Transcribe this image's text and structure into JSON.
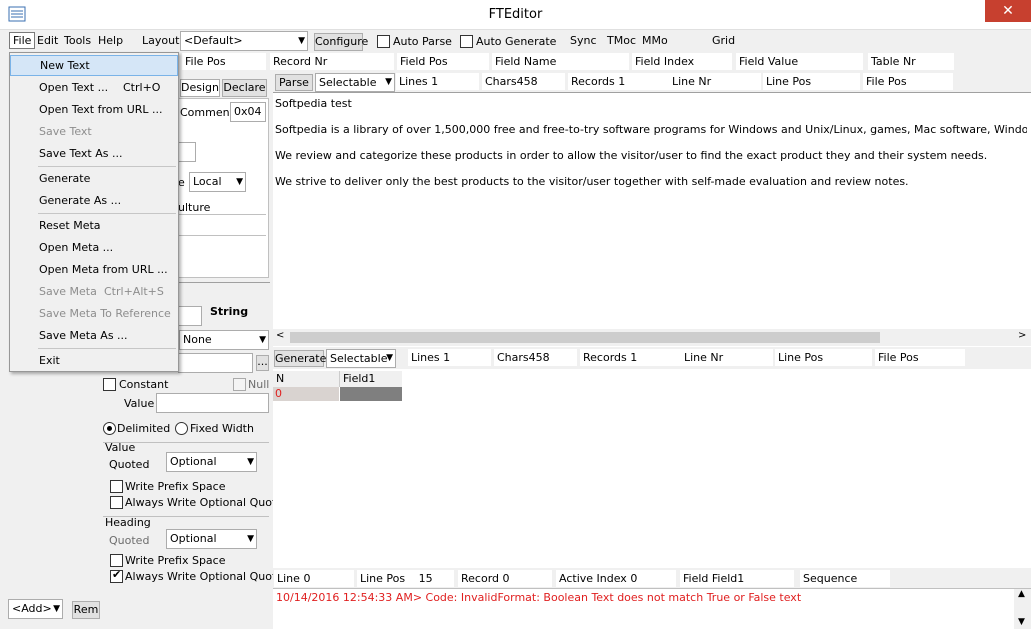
{
  "window": {
    "title": "FTEditor",
    "close": "✕"
  },
  "menubar": {
    "file": "File",
    "edit": "Edit",
    "tools": "Tools",
    "help": "Help",
    "layout": "Layout"
  },
  "toolbar": {
    "layout_value": "<Default>",
    "configure": "Configure",
    "auto_parse": "Auto Parse",
    "auto_generate": "Auto Generate",
    "sync": "Sync",
    "tmoc": "TMoc",
    "mmo": "MMo",
    "grid": "Grid"
  },
  "field_header": [
    "File Pos",
    "Record Nr",
    "Field Pos",
    "Field Name",
    "Field Index",
    "Field Value",
    "Table Nr"
  ],
  "file_menu": {
    "items": [
      {
        "label": "New Text",
        "shortcut": "",
        "disabled": false
      },
      {
        "label": "Open Text ...",
        "shortcut": "Ctrl+O",
        "disabled": false
      },
      {
        "label": "Open Text from URL ...",
        "shortcut": "",
        "disabled": false
      },
      {
        "label": "Save Text",
        "shortcut": "",
        "disabled": true
      },
      {
        "label": "Save Text As ...",
        "shortcut": "",
        "disabled": false
      },
      {
        "label": "Generate",
        "shortcut": "",
        "disabled": false
      },
      {
        "label": "Generate As ...",
        "shortcut": "",
        "disabled": false
      },
      {
        "label": "Reset Meta",
        "shortcut": "",
        "disabled": false
      },
      {
        "label": "Open Meta ...",
        "shortcut": "",
        "disabled": false
      },
      {
        "label": "Open Meta from URL ...",
        "shortcut": "",
        "disabled": false
      },
      {
        "label": "Save Meta",
        "shortcut": "Ctrl+Alt+S",
        "disabled": true
      },
      {
        "label": "Save Meta To Reference",
        "shortcut": "",
        "disabled": true
      },
      {
        "label": "Save Meta As ...",
        "shortcut": "",
        "disabled": false
      },
      {
        "label": "Exit",
        "shortcut": "",
        "disabled": false
      }
    ]
  },
  "left": {
    "tab_design": "Design",
    "tab_declare": "Declare",
    "comment_label": "Comment",
    "comment_value": "0x04",
    "local_value": "Local",
    "culture_label": "ulture",
    "string_label": "String",
    "none_value": "None",
    "constant": "Constant",
    "null_label": "Null",
    "value_label": "Value",
    "delimited": "Delimited",
    "fixed_width": "Fixed Width",
    "value_section": "Value",
    "quoted_label": "Quoted",
    "quoted_value": "Optional",
    "write_prefix_space": "Write Prefix Space",
    "always_write_optional_quote": "Always Write Optional Quote",
    "heading_section": "Heading",
    "heading_quoted_label": "Quoted",
    "heading_quoted_value": "Optional",
    "heading_write_prefix_space": "Write Prefix Space",
    "heading_always_write_optional_quote": "Always Write Optional Quote",
    "add_button": "<Add>",
    "rem_button": "Rem",
    "ellipsis": "..."
  },
  "parse_bar": {
    "parse": "Parse",
    "selectable": "Selectable",
    "lines": "Lines",
    "lines_value": "1",
    "chars": "Chars",
    "chars_value": "458",
    "records": "Records",
    "records_value": "1",
    "line_nr": "Line Nr",
    "line_pos": "Line Pos",
    "file_pos": "File Pos"
  },
  "text_content": [
    "Softpedia test",
    "Softpedia is a library of over 1,500,000 free and free-to-try software programs for Windows and Unix/Linux, games, Mac software, Windows drivers, mobil",
    "We review and categorize these products in order to allow the visitor/user to find the exact product they and their system needs.",
    "We strive to deliver only the best products to the visitor/user together with self-made evaluation and review notes."
  ],
  "generate_bar": {
    "generate": "Generate",
    "selectable": "Selectable",
    "lines": "Lines",
    "lines_value": "1",
    "chars": "Chars",
    "chars_value": "458",
    "records": "Records",
    "records_value": "1",
    "line_nr": "Line Nr",
    "line_pos": "Line Pos",
    "file_pos": "File Pos"
  },
  "grid": {
    "col_n": "N",
    "col_field1": "Field1",
    "row0_n": "0"
  },
  "status": {
    "line": "Line",
    "line_value": "0",
    "line_pos": "Line Pos",
    "line_pos_value": "15",
    "record": "Record",
    "record_value": "0",
    "active_index": "Active Index",
    "active_index_value": "0",
    "field": "Field",
    "field_value": "Field1",
    "sequence": "Sequence"
  },
  "log": {
    "message": "10/14/2016 12:54:33 AM> Code: InvalidFormat: Boolean Text does not match True or False text",
    "color": "#e02020"
  },
  "colors": {
    "highlight": "#d5e6f7",
    "close_button": "#c7402f"
  }
}
